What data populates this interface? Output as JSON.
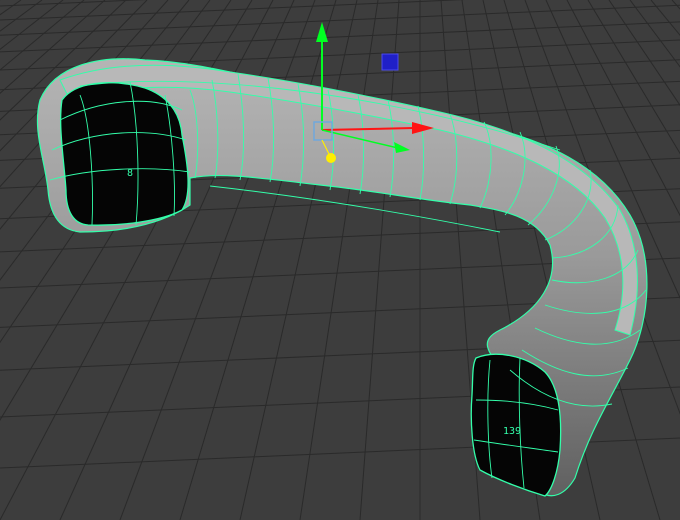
{
  "viewport": {
    "background": "#3d3d3d",
    "grid_color": "#2a2a2a",
    "wireframe_color": "#33ffaa",
    "mesh_fill": "#8a8a8a",
    "interior_fill": "#050505"
  },
  "mesh": {
    "selection_state": "selected",
    "vertex_labels": [
      {
        "text": "8"
      },
      {
        "text": "139"
      }
    ]
  },
  "manipulator": {
    "axis_y_color": "#00ff22",
    "axis_x_color": "#ff1414",
    "axis_z_color": "#1a1ad9",
    "center_color": "#6fa8dc",
    "pivot_color": "#ffee00"
  }
}
